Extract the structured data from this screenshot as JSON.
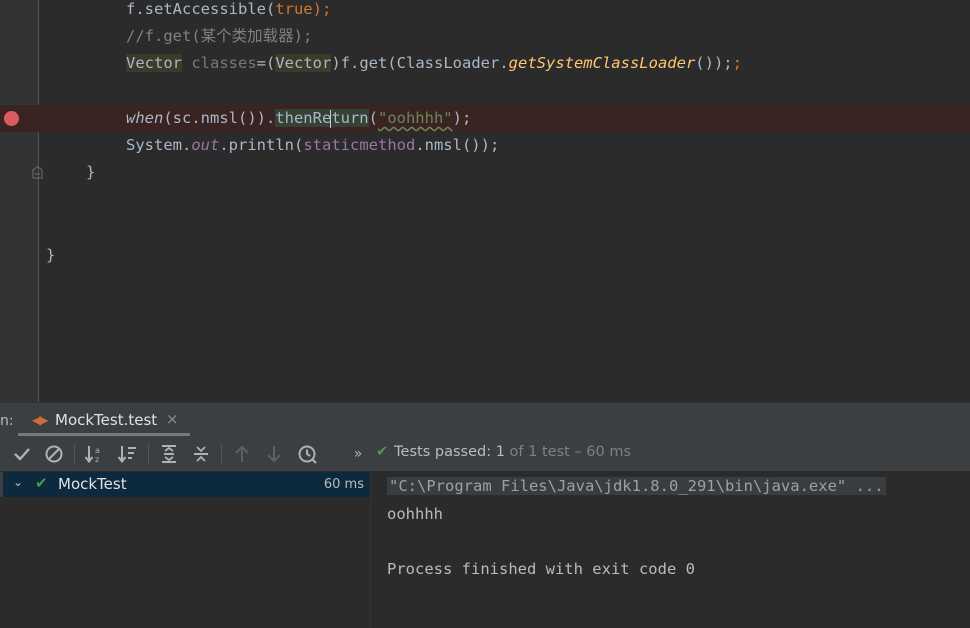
{
  "editor": {
    "lines": {
      "l1": {
        "obj": "f.setAccessible(",
        "kw": "true",
        "end": ");"
      },
      "l2": {
        "comment": "//f.get(某个类加载器);"
      },
      "l3": {
        "type1": "Vector",
        "var": "classes",
        "eq": "=(",
        "type2": "Vector",
        "mid": ")f.get(ClassLoader.",
        "method": "getSystemClassLoader",
        "end": "());"
      },
      "l4": {
        "when": "when",
        "a": "(sc.nmsl()).",
        "m1": "thenRe",
        "m2": "turn",
        "b": "(",
        "str": "\"oohhhh\"",
        "end": ");"
      },
      "l5": {
        "a": "System.",
        "out": "out",
        "b": ".println(",
        "v": "staticmethod",
        "end": ".nmsl());"
      },
      "l6": {
        "brace": "}"
      },
      "l7": {
        "brace": "}"
      }
    }
  },
  "run": {
    "label": "n:",
    "tab": {
      "label": "MockTest.test",
      "close": "×"
    },
    "toolbar": {
      "tooltip_more": "»"
    },
    "status": {
      "passed": "Tests passed:",
      "count": "1",
      "rest": "of 1 test – 60 ms"
    },
    "tree": {
      "name": "MockTest",
      "time": "60 ms"
    },
    "console": {
      "cmd": "\"C:\\Program Files\\Java\\jdk1.8.0_291\\bin\\java.exe\" ...",
      "out": "oohhhh",
      "exit": "Process finished with exit code 0"
    }
  },
  "colors": {
    "passed": "#499c54",
    "breakpoint": "#db5c5c",
    "selection": "#0d293e"
  }
}
